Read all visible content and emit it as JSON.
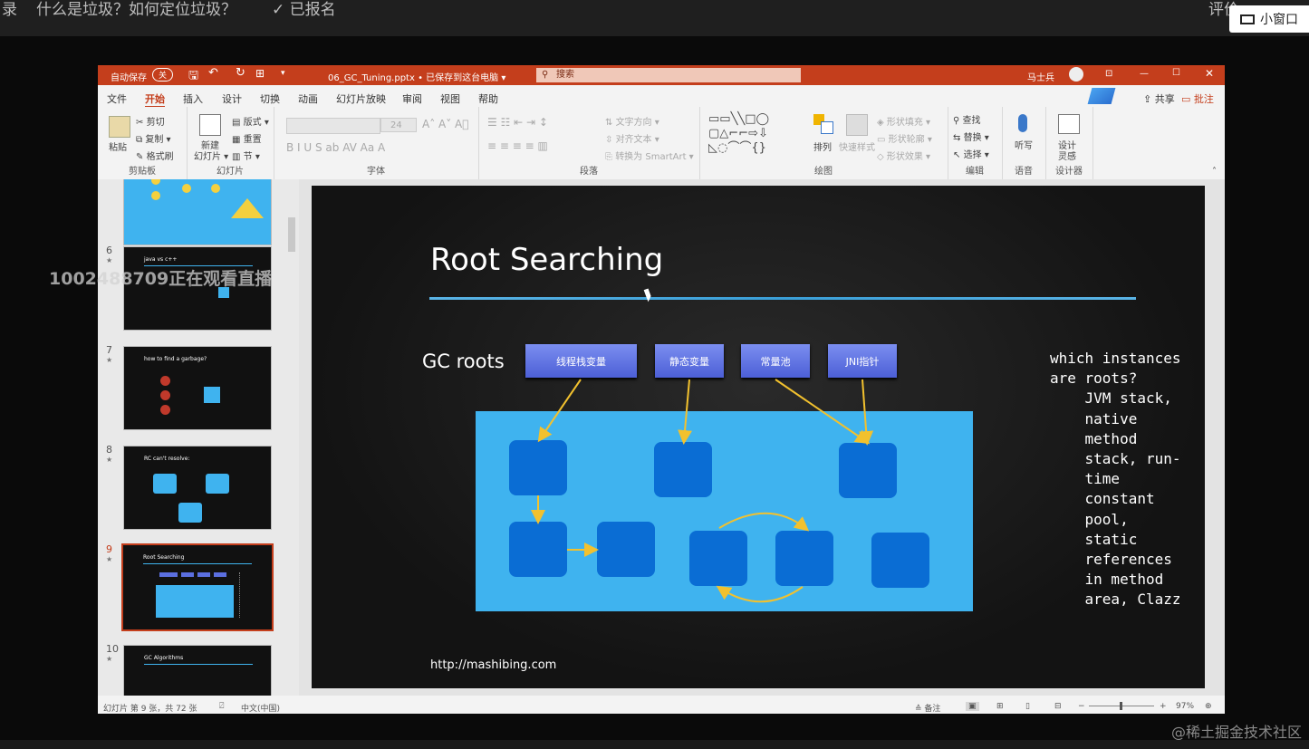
{
  "top": {
    "left_fragment": "录",
    "course_title": "什么是垃圾？如何定位垃圾？",
    "enrolled": "已报名",
    "rate": "评价",
    "mini_window": "小窗口"
  },
  "viewers": "1002488709正在观看直播",
  "ppt": {
    "autosave": "自动保存",
    "autosave_state": "关",
    "filename": "06_GC_Tuning.pptx • 已保存到这台电脑 ▾",
    "search_placeholder": "搜索",
    "user": "马士兵",
    "menu": [
      "文件",
      "开始",
      "插入",
      "设计",
      "切换",
      "动画",
      "幻灯片放映",
      "审阅",
      "视图",
      "帮助"
    ],
    "share": "共享",
    "comment": "批注",
    "ribbon": {
      "clipboard": {
        "paste": "粘贴",
        "cut": "剪切",
        "copy": "复制",
        "format_painter": "格式刷",
        "label": "剪贴板"
      },
      "slides": {
        "new_slide": "新建",
        "new_slide2": "幻灯片",
        "layout": "版式",
        "reset": "重置",
        "section": "节",
        "label": "幻灯片"
      },
      "font": {
        "size": "24",
        "label": "字体"
      },
      "paragraph": {
        "text_direction": "文字方向",
        "align_text": "对齐文本",
        "smartart": "转换为 SmartArt",
        "label": "段落"
      },
      "drawing": {
        "arrange": "排列",
        "quick_styles": "快速样式",
        "fill": "形状填充",
        "outline": "形状轮廓",
        "effects": "形状效果",
        "label": "绘图"
      },
      "editing": {
        "find": "查找",
        "replace": "替换",
        "select": "选择",
        "label": "编辑"
      },
      "voice": {
        "dictate": "听写",
        "label": "语音"
      },
      "designer": {
        "design": "设计",
        "ideas": "灵感",
        "label": "设计器"
      }
    },
    "thumbnails": [
      {
        "num": "6",
        "title": "java vs c++"
      },
      {
        "num": "7",
        "title": "how to find a garbage?"
      },
      {
        "num": "8",
        "title": "RC can't resolve:"
      },
      {
        "num": "9",
        "title": "Root Searching"
      },
      {
        "num": "10",
        "title": "GC Algorithms"
      }
    ],
    "slide": {
      "title": "Root Searching",
      "gc_roots": "GC roots",
      "roots": [
        "线程栈变量",
        "静态变量",
        "常量池",
        "JNI指针"
      ],
      "side_text": "which instances\nare roots?\n    JVM stack,\n    native\n    method\n    stack, run-\n    time\n    constant\n    pool,\n    static\n    references\n    in method\n    area, Clazz",
      "url": "http://mashibing.com"
    },
    "status": {
      "slide_info": "幻灯片 第 9 张，共 72 张",
      "lang": "中文(中国)",
      "notes": "备注",
      "zoom": "97%"
    }
  },
  "watermark": "@稀土掘金技术社区",
  "colors": {
    "title_bar": "#c43e1c",
    "heap": "#3fb3ef",
    "object": "#0a6dd4",
    "arrow": "#f2c12e",
    "root_button": "#5b6fe0"
  }
}
